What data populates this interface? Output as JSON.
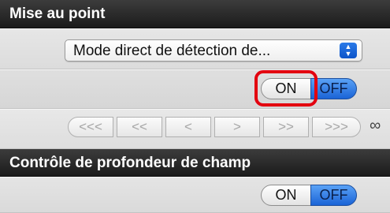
{
  "focus_section": {
    "title": "Mise au point",
    "mode_select_value": "Mode direct de détection de...",
    "toggle": {
      "on_label": "ON",
      "off_label": "OFF",
      "selected": "OFF"
    },
    "nav_buttons": [
      "<<<",
      "<<",
      "<",
      ">",
      ">>",
      ">>>"
    ],
    "infinity_symbol": "∞"
  },
  "dof_section": {
    "title": "Contrôle de profondeur de champ",
    "toggle": {
      "on_label": "ON",
      "off_label": "OFF",
      "selected": "OFF"
    }
  },
  "colors": {
    "highlight": "#e3000f",
    "off_active": "#2a78e6",
    "header_bg": "#2a2a2a"
  }
}
